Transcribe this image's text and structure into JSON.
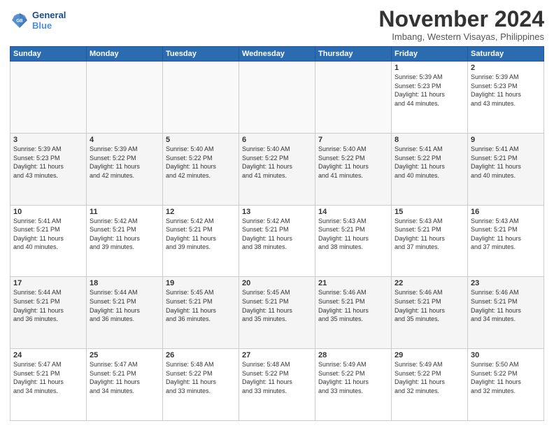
{
  "header": {
    "logo_line1": "General",
    "logo_line2": "Blue",
    "month": "November 2024",
    "location": "Imbang, Western Visayas, Philippines"
  },
  "weekdays": [
    "Sunday",
    "Monday",
    "Tuesday",
    "Wednesday",
    "Thursday",
    "Friday",
    "Saturday"
  ],
  "weeks": [
    [
      {
        "day": "",
        "info": ""
      },
      {
        "day": "",
        "info": ""
      },
      {
        "day": "",
        "info": ""
      },
      {
        "day": "",
        "info": ""
      },
      {
        "day": "",
        "info": ""
      },
      {
        "day": "1",
        "info": "Sunrise: 5:39 AM\nSunset: 5:23 PM\nDaylight: 11 hours\nand 44 minutes."
      },
      {
        "day": "2",
        "info": "Sunrise: 5:39 AM\nSunset: 5:23 PM\nDaylight: 11 hours\nand 43 minutes."
      }
    ],
    [
      {
        "day": "3",
        "info": "Sunrise: 5:39 AM\nSunset: 5:23 PM\nDaylight: 11 hours\nand 43 minutes."
      },
      {
        "day": "4",
        "info": "Sunrise: 5:39 AM\nSunset: 5:22 PM\nDaylight: 11 hours\nand 42 minutes."
      },
      {
        "day": "5",
        "info": "Sunrise: 5:40 AM\nSunset: 5:22 PM\nDaylight: 11 hours\nand 42 minutes."
      },
      {
        "day": "6",
        "info": "Sunrise: 5:40 AM\nSunset: 5:22 PM\nDaylight: 11 hours\nand 41 minutes."
      },
      {
        "day": "7",
        "info": "Sunrise: 5:40 AM\nSunset: 5:22 PM\nDaylight: 11 hours\nand 41 minutes."
      },
      {
        "day": "8",
        "info": "Sunrise: 5:41 AM\nSunset: 5:22 PM\nDaylight: 11 hours\nand 40 minutes."
      },
      {
        "day": "9",
        "info": "Sunrise: 5:41 AM\nSunset: 5:21 PM\nDaylight: 11 hours\nand 40 minutes."
      }
    ],
    [
      {
        "day": "10",
        "info": "Sunrise: 5:41 AM\nSunset: 5:21 PM\nDaylight: 11 hours\nand 40 minutes."
      },
      {
        "day": "11",
        "info": "Sunrise: 5:42 AM\nSunset: 5:21 PM\nDaylight: 11 hours\nand 39 minutes."
      },
      {
        "day": "12",
        "info": "Sunrise: 5:42 AM\nSunset: 5:21 PM\nDaylight: 11 hours\nand 39 minutes."
      },
      {
        "day": "13",
        "info": "Sunrise: 5:42 AM\nSunset: 5:21 PM\nDaylight: 11 hours\nand 38 minutes."
      },
      {
        "day": "14",
        "info": "Sunrise: 5:43 AM\nSunset: 5:21 PM\nDaylight: 11 hours\nand 38 minutes."
      },
      {
        "day": "15",
        "info": "Sunrise: 5:43 AM\nSunset: 5:21 PM\nDaylight: 11 hours\nand 37 minutes."
      },
      {
        "day": "16",
        "info": "Sunrise: 5:43 AM\nSunset: 5:21 PM\nDaylight: 11 hours\nand 37 minutes."
      }
    ],
    [
      {
        "day": "17",
        "info": "Sunrise: 5:44 AM\nSunset: 5:21 PM\nDaylight: 11 hours\nand 36 minutes."
      },
      {
        "day": "18",
        "info": "Sunrise: 5:44 AM\nSunset: 5:21 PM\nDaylight: 11 hours\nand 36 minutes."
      },
      {
        "day": "19",
        "info": "Sunrise: 5:45 AM\nSunset: 5:21 PM\nDaylight: 11 hours\nand 36 minutes."
      },
      {
        "day": "20",
        "info": "Sunrise: 5:45 AM\nSunset: 5:21 PM\nDaylight: 11 hours\nand 35 minutes."
      },
      {
        "day": "21",
        "info": "Sunrise: 5:46 AM\nSunset: 5:21 PM\nDaylight: 11 hours\nand 35 minutes."
      },
      {
        "day": "22",
        "info": "Sunrise: 5:46 AM\nSunset: 5:21 PM\nDaylight: 11 hours\nand 35 minutes."
      },
      {
        "day": "23",
        "info": "Sunrise: 5:46 AM\nSunset: 5:21 PM\nDaylight: 11 hours\nand 34 minutes."
      }
    ],
    [
      {
        "day": "24",
        "info": "Sunrise: 5:47 AM\nSunset: 5:21 PM\nDaylight: 11 hours\nand 34 minutes."
      },
      {
        "day": "25",
        "info": "Sunrise: 5:47 AM\nSunset: 5:21 PM\nDaylight: 11 hours\nand 34 minutes."
      },
      {
        "day": "26",
        "info": "Sunrise: 5:48 AM\nSunset: 5:22 PM\nDaylight: 11 hours\nand 33 minutes."
      },
      {
        "day": "27",
        "info": "Sunrise: 5:48 AM\nSunset: 5:22 PM\nDaylight: 11 hours\nand 33 minutes."
      },
      {
        "day": "28",
        "info": "Sunrise: 5:49 AM\nSunset: 5:22 PM\nDaylight: 11 hours\nand 33 minutes."
      },
      {
        "day": "29",
        "info": "Sunrise: 5:49 AM\nSunset: 5:22 PM\nDaylight: 11 hours\nand 32 minutes."
      },
      {
        "day": "30",
        "info": "Sunrise: 5:50 AM\nSunset: 5:22 PM\nDaylight: 11 hours\nand 32 minutes."
      }
    ]
  ]
}
